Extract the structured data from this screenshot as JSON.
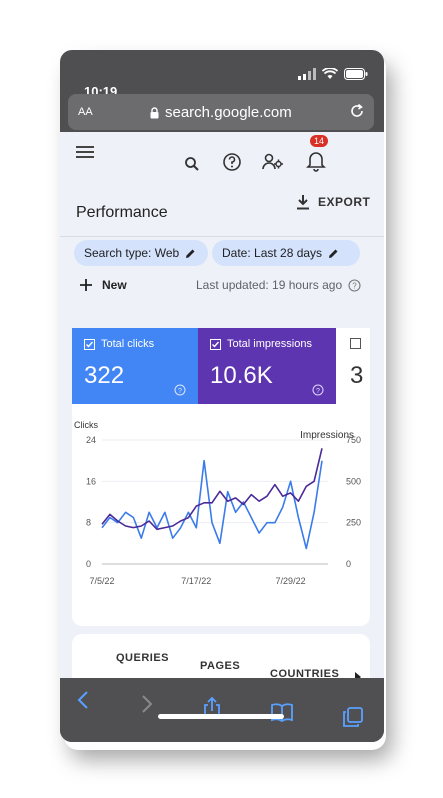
{
  "status": {
    "time": "10:19"
  },
  "browser": {
    "text_size": "AA",
    "url": "search.google.com"
  },
  "nav": {
    "badge_count": "14"
  },
  "page": {
    "title": "Performance",
    "export_label": "EXPORT"
  },
  "filters": [
    {
      "label": "Search type: Web"
    },
    {
      "label": "Date: Last 28 days"
    }
  ],
  "actions": {
    "new_label": "New",
    "last_updated": "Last updated: 19 hours ago"
  },
  "metrics": [
    {
      "label": "Total clicks",
      "value": "322",
      "color": "#4285f4",
      "checked": true
    },
    {
      "label": "Total impressions",
      "value": "10.6K",
      "color": "#5e35b1",
      "checked": true
    },
    {
      "label": "",
      "value": "3",
      "color": "#ffffff",
      "checked": false
    }
  ],
  "chart_data": {
    "type": "line",
    "y_left_label": "Clicks",
    "y_right_label": "Impressions",
    "y_left_ticks": [
      "24",
      "16",
      "8",
      "0"
    ],
    "y_right_ticks": [
      "750",
      "500",
      "250",
      "0"
    ],
    "ylim_left": [
      0,
      24
    ],
    "ylim_right": [
      0,
      750
    ],
    "x_ticks": [
      "7/5/22",
      "7/17/22",
      "7/29/22"
    ],
    "x_tick_index": [
      0,
      12,
      24
    ],
    "series": [
      {
        "name": "Clicks",
        "axis": "left",
        "color": "#3b7bea",
        "values": [
          7,
          9,
          8,
          10,
          9,
          5,
          10,
          7,
          10,
          5,
          7,
          10,
          7,
          20,
          8,
          4,
          14,
          10,
          12,
          9,
          6,
          8,
          8,
          11,
          16,
          9,
          3,
          10,
          20
        ]
      },
      {
        "name": "Impressions",
        "axis": "right",
        "color": "#4a2a9a",
        "values": [
          240,
          300,
          260,
          230,
          220,
          230,
          260,
          210,
          220,
          230,
          260,
          280,
          350,
          370,
          370,
          440,
          380,
          400,
          360,
          420,
          380,
          410,
          480,
          410,
          430,
          380,
          470,
          500,
          700
        ]
      }
    ],
    "grid": true
  },
  "tabs": [
    {
      "label": "QUERIES"
    },
    {
      "label": "PAGES"
    },
    {
      "label": "COUNTRIES"
    }
  ]
}
